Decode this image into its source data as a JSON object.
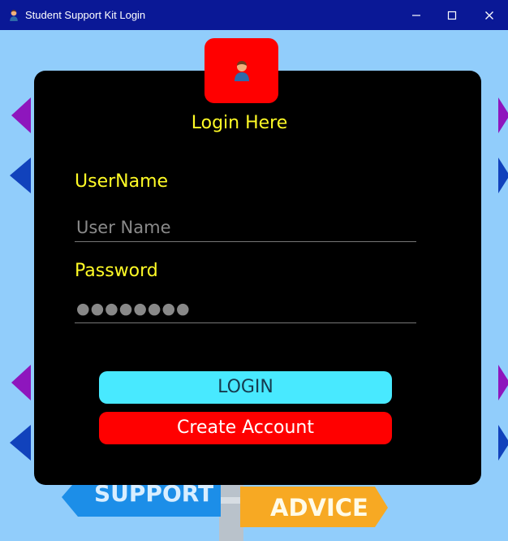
{
  "window": {
    "title": "Student Support Kit Login",
    "controls": [
      "minimize",
      "maximize",
      "close"
    ]
  },
  "login": {
    "heading": "Login Here",
    "username_label": "UserName",
    "username_placeholder": "User Name",
    "password_label": "Password",
    "password_value": "●●●●●●●●",
    "login_button": "LOGIN",
    "create_account_button": "Create Account"
  },
  "background": {
    "support_text": "SUPPORT",
    "advice_text": "ADVICE"
  },
  "colors": {
    "titlebar": "#0a1896",
    "panel": "#000000",
    "accent_yellow": "#fffb26",
    "login_button": "#48e9ff",
    "create_button": "#ff0000"
  },
  "icons": {
    "window_icon": "user-icon",
    "avatar_icon": "user-icon"
  }
}
